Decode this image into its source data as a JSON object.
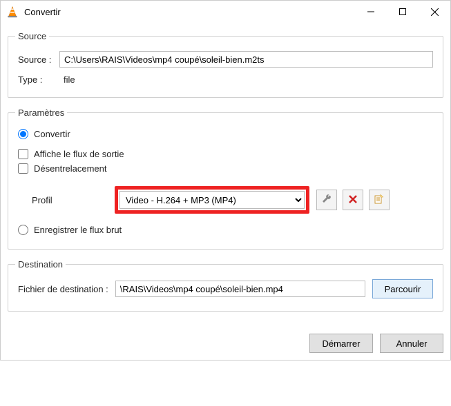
{
  "window": {
    "title": "Convertir"
  },
  "source_group": {
    "legend": "Source",
    "source_label": "Source :",
    "source_value": "C:\\Users\\RAIS\\Videos\\mp4 coupé\\soleil-bien.m2ts",
    "type_label": "Type :",
    "type_value": "file"
  },
  "params_group": {
    "legend": "Paramètres",
    "radio_convert": "Convertir",
    "checkbox_show_output": "Affiche le flux de sortie",
    "checkbox_deinterlace": "Désentrelacement",
    "profile_label": "Profil",
    "profile_selected": "Video - H.264 + MP3 (MP4)",
    "radio_rawstream": "Enregistrer le flux brut"
  },
  "dest_group": {
    "legend": "Destination",
    "dest_label": "Fichier de destination :",
    "dest_value": "\\RAIS\\Videos\\mp4 coupé\\soleil-bien.mp4",
    "browse_label": "Parcourir"
  },
  "buttons": {
    "start": "Démarrer",
    "cancel": "Annuler"
  }
}
